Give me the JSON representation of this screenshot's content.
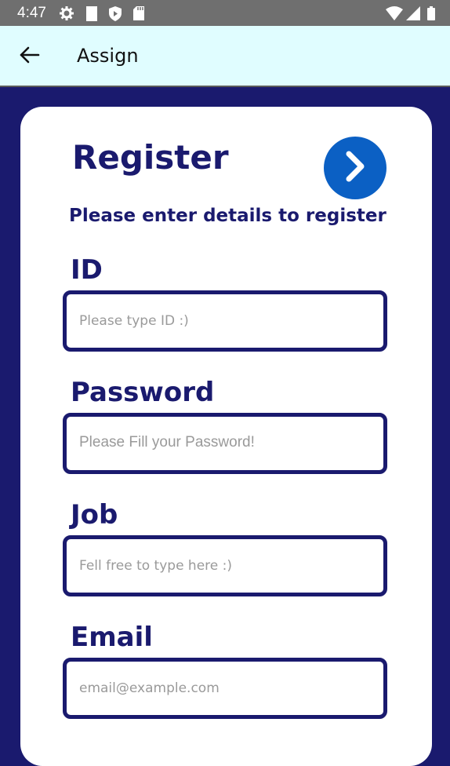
{
  "status_bar": {
    "time": "4:47",
    "icons": [
      "gear-icon",
      "sim-icon",
      "shield-icon",
      "sd-card-icon",
      "wifi-icon",
      "signal-icon",
      "battery-icon"
    ]
  },
  "app_bar": {
    "title": "Assign",
    "back_icon": "arrow-left-icon",
    "background": "#e0fdff"
  },
  "form": {
    "title": "Register",
    "subtitle": "Please enter details to register",
    "next_icon": "chevron-right-icon",
    "fields": [
      {
        "label": "ID",
        "placeholder": "Please type ID :)",
        "value": ""
      },
      {
        "label": "Password",
        "placeholder": "Please Fill your Password!",
        "value": ""
      },
      {
        "label": "Job",
        "placeholder": "Fell free to type here :)",
        "value": ""
      },
      {
        "label": "Email",
        "placeholder": "email@example.com",
        "value": ""
      }
    ]
  },
  "colors": {
    "primary": "#1a1a6e",
    "accent": "#0b60c4",
    "placeholder": "#9a9a9a",
    "card": "#ffffff"
  }
}
